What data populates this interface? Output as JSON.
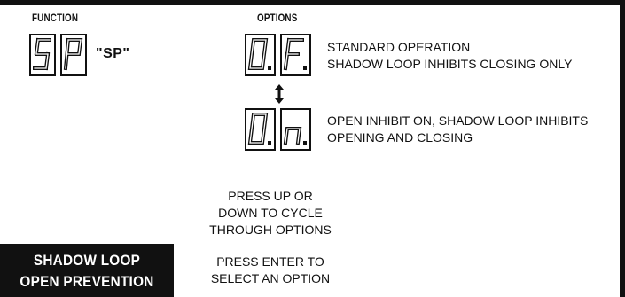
{
  "headers": {
    "function": "FUNCTION",
    "options": "OPTIONS"
  },
  "function_display": {
    "digits": [
      "S",
      "P"
    ],
    "quoted_code": "\"SP\""
  },
  "options": [
    {
      "digits": [
        "0.",
        "F."
      ],
      "lines": [
        "STANDARD OPERATION",
        "SHADOW LOOP INHIBITS CLOSING ONLY"
      ]
    },
    {
      "digits": [
        "0.",
        "n."
      ],
      "lines": [
        "OPEN INHIBIT ON, SHADOW LOOP INHIBITS",
        "OPENING AND CLOSING"
      ]
    }
  ],
  "cycle_arrow_icon": "up-down-arrow-icon",
  "instructions": {
    "cycle": [
      "PRESS UP OR",
      "DOWN TO CYCLE",
      "THROUGH OPTIONS"
    ],
    "select": [
      "PRESS ENTER TO",
      "SELECT AN OPTION"
    ]
  },
  "title_badge": {
    "lines": [
      "SHADOW LOOP",
      "OPEN PREVENTION"
    ]
  }
}
